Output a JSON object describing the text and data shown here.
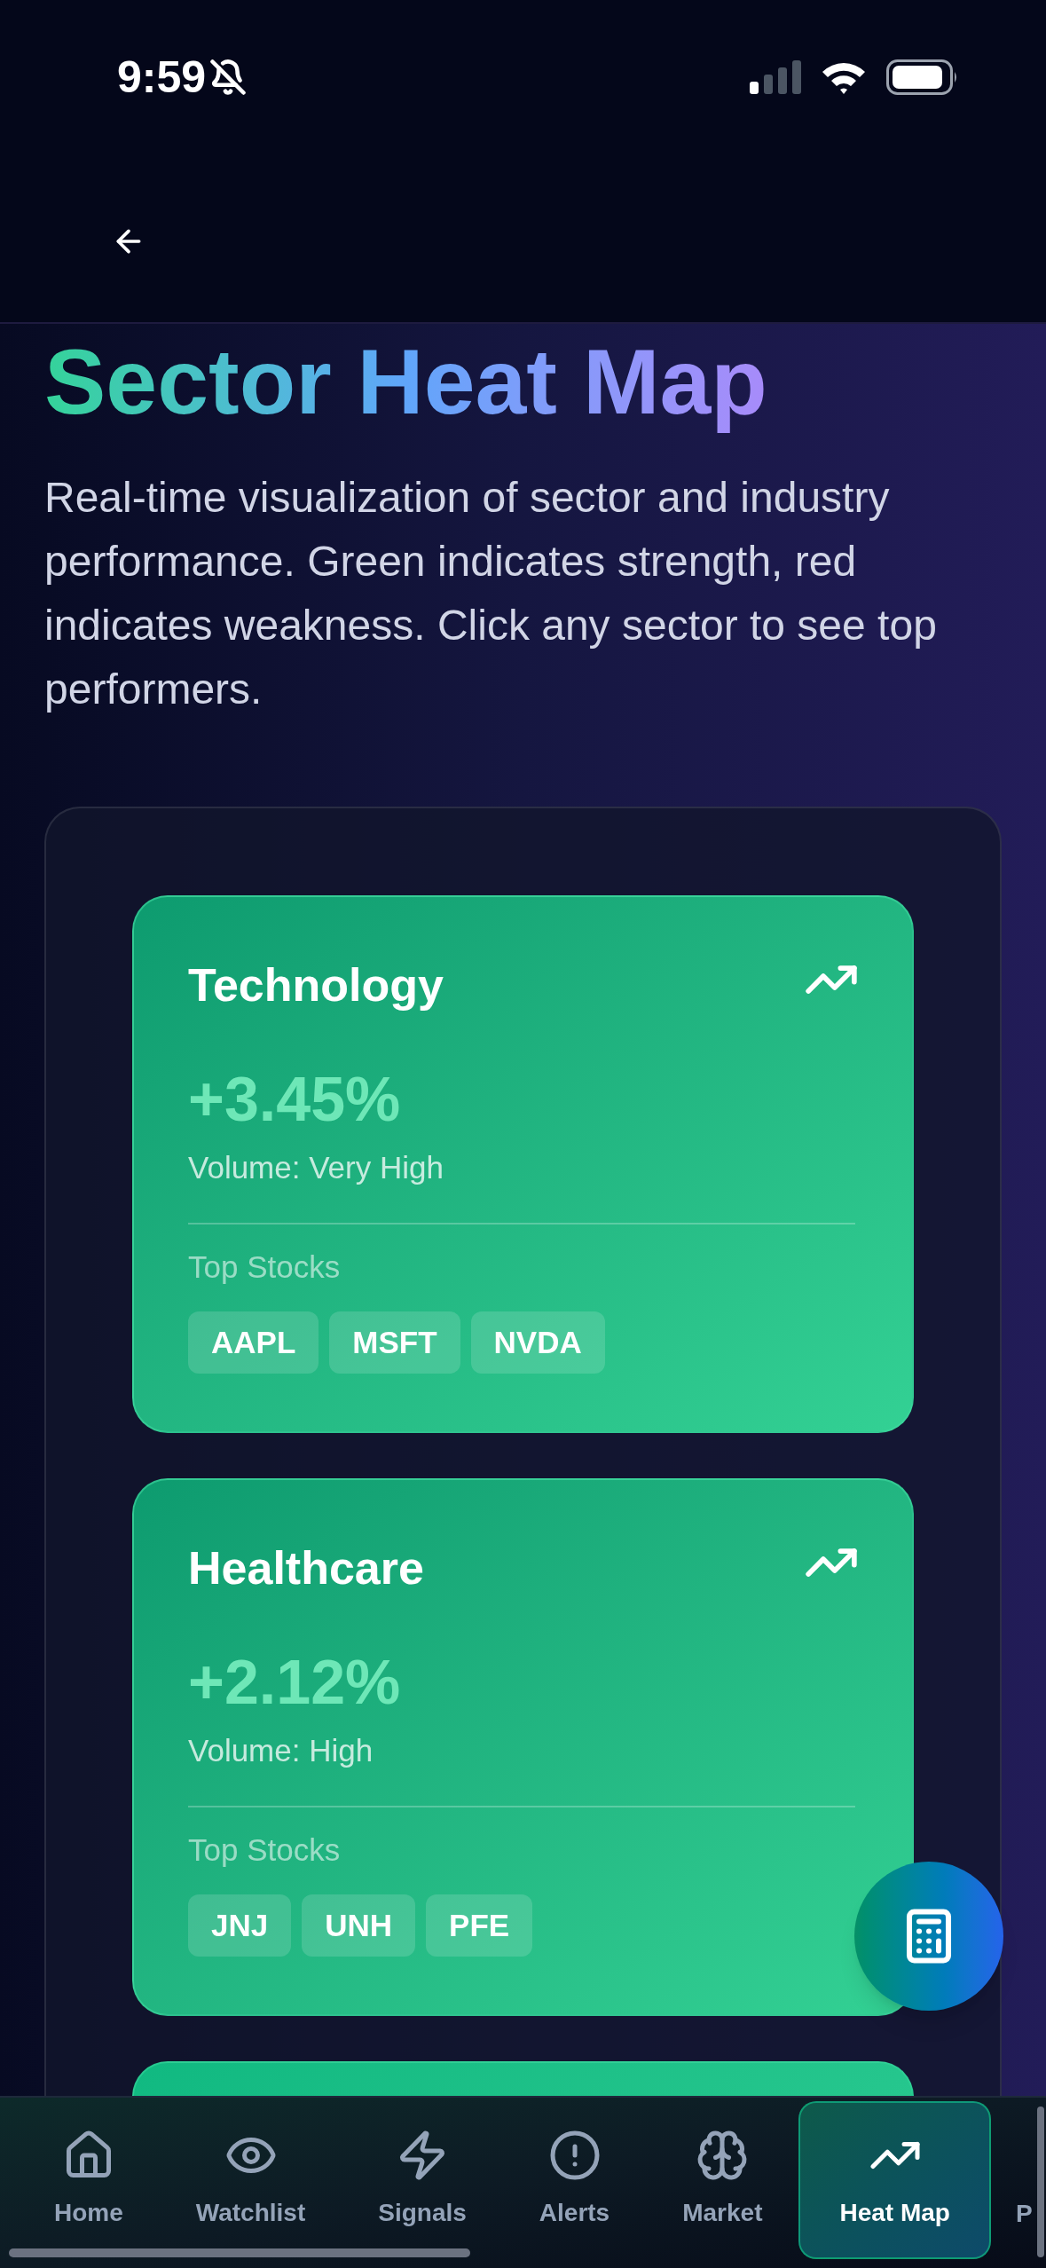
{
  "status_bar": {
    "time": "9:59"
  },
  "title": "Sector Heat Map",
  "description": "Real-time visualization of sector and industry performance. Green indicates strength, red indicates weakness. Click any sector to see top performers.",
  "sectors": [
    {
      "kind": "full",
      "name": "Technology",
      "change": "+3.45%",
      "volume": "Volume: Very High",
      "top_label": "Top Stocks",
      "stocks": [
        "AAPL",
        "MSFT",
        "NVDA"
      ]
    },
    {
      "kind": "full",
      "name": "Healthcare",
      "change": "+2.12%",
      "volume": "Volume: High",
      "top_label": "Top Stocks",
      "stocks": [
        "JNJ",
        "UNH",
        "PFE"
      ]
    },
    {
      "kind": "clipped"
    }
  ],
  "nav": [
    {
      "label": "Home",
      "selected": false
    },
    {
      "label": "Watchlist",
      "selected": false
    },
    {
      "label": "Signals",
      "selected": false
    },
    {
      "label": "Alerts",
      "selected": false
    },
    {
      "label": "Market",
      "selected": false
    },
    {
      "label": "Heat Map",
      "selected": true
    },
    {
      "label": "P",
      "selected": false
    }
  ]
}
